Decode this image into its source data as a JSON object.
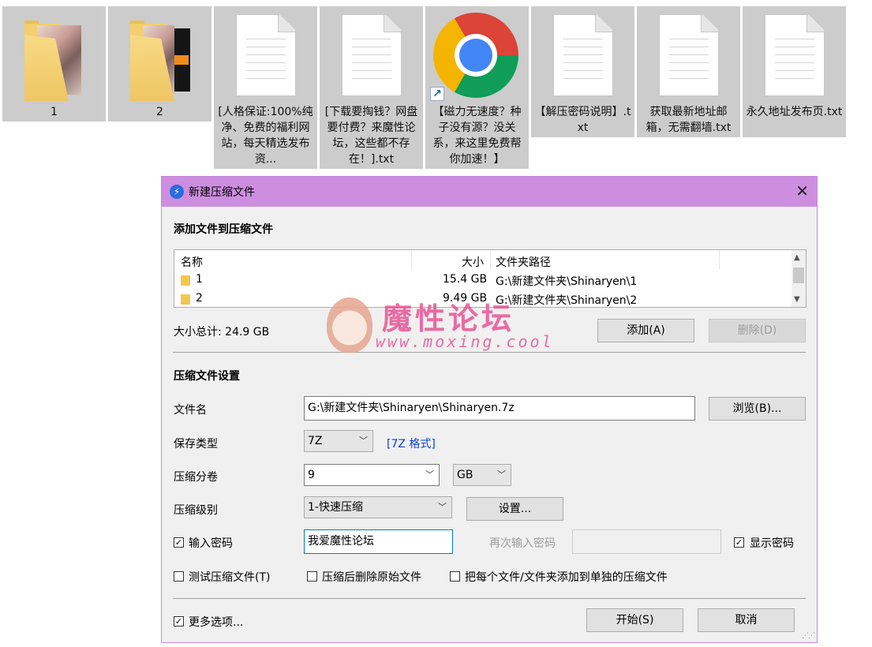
{
  "desktop": {
    "items": [
      {
        "label": "1",
        "kind": "folder"
      },
      {
        "label": "2",
        "kind": "folder"
      },
      {
        "label": "[人格保证:100%纯净、免费的福利网站，每天精选发布资...",
        "kind": "txt"
      },
      {
        "label": "[下载要掏钱？网盘要付费？来魔性论坛，这些都不存在！].txt",
        "kind": "txt"
      },
      {
        "label": "【磁力无速度？种子没有源？没关系，来这里免费帮你加速！】",
        "kind": "chrome-shortcut"
      },
      {
        "label": "【解压密码说明】.txt",
        "kind": "txt"
      },
      {
        "label": "获取最新地址邮箱，无需翻墙.txt",
        "kind": "txt"
      },
      {
        "label": "永久地址发布页.txt",
        "kind": "txt"
      }
    ]
  },
  "dialog": {
    "title": "新建压缩文件",
    "add_section_title": "添加文件到压缩文件",
    "list_headers": {
      "name": "名称",
      "size": "大小",
      "path": "文件夹路径"
    },
    "files": [
      {
        "name": "1",
        "size": "15.4 GB",
        "path": "G:\\新建文件夹\\Shinaryen\\1"
      },
      {
        "name": "2",
        "size": "9.49 GB",
        "path": "G:\\新建文件夹\\Shinaryen\\2"
      }
    ],
    "total_size": "大小总计: 24.9 GB",
    "add_button": "添加(A)",
    "delete_button": "删除(D)",
    "settings_title": "压缩文件设置",
    "filename_label": "文件名",
    "filename_value": "G:\\新建文件夹\\Shinaryen\\Shinaryen.7z",
    "browse_button": "浏览(B)...",
    "save_type_label": "保存类型",
    "save_type_value": "7Z",
    "format_link": "[7Z 格式]",
    "split_label": "压缩分卷",
    "split_value": "9",
    "split_unit": "GB",
    "level_label": "压缩级别",
    "level_value": "1-快速压缩",
    "settings_button": "设置...",
    "password_label": "输入密码",
    "password_checked": true,
    "password_value": "我爱魔性论坛",
    "reenter_label": "再次输入密码",
    "show_password_label": "显示密码",
    "show_password_checked": true,
    "test_label": "测试压缩文件(T)",
    "delete_after_label": "压缩后删除原始文件",
    "separate_label": "把每个文件/文件夹添加到单独的压缩文件",
    "more_options_label": "更多选项...",
    "more_options_checked": true,
    "start_button": "开始(S)",
    "cancel_button": "取消"
  },
  "watermark": {
    "title": "魔性论坛",
    "url": "www.moxing.cool"
  }
}
